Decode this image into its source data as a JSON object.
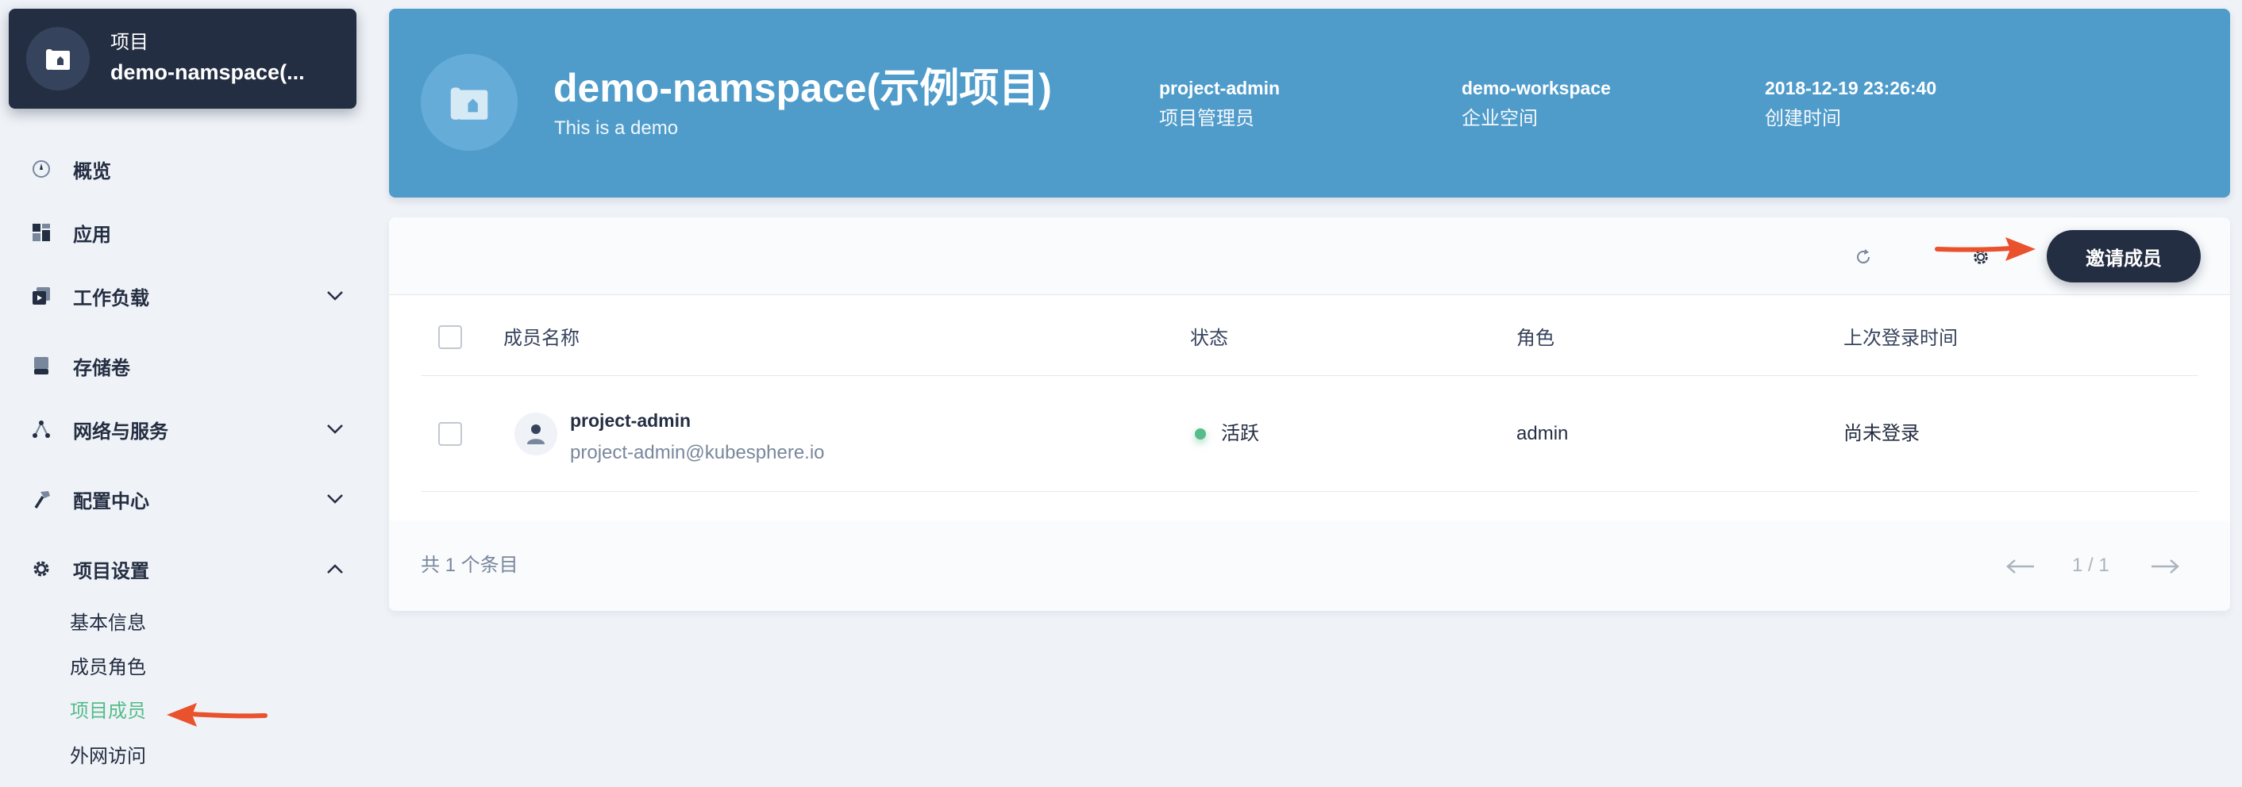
{
  "project_card": {
    "kind": "项目",
    "name": "demo-namspace(..."
  },
  "sidebar": {
    "items": [
      {
        "label": "概览"
      },
      {
        "label": "应用"
      },
      {
        "label": "工作负载"
      },
      {
        "label": "存储卷"
      },
      {
        "label": "网络与服务"
      },
      {
        "label": "配置中心"
      },
      {
        "label": "项目设置"
      }
    ],
    "sub_items": [
      {
        "label": "基本信息"
      },
      {
        "label": "成员角色"
      },
      {
        "label": "项目成员"
      },
      {
        "label": "外网访问"
      }
    ]
  },
  "banner": {
    "title": "demo-namspace(示例项目)",
    "description": "This is a demo",
    "meta": [
      {
        "value": "project-admin",
        "key": "项目管理员"
      },
      {
        "value": "demo-workspace",
        "key": "企业空间"
      },
      {
        "value": "2018-12-19 23:26:40",
        "key": "创建时间"
      }
    ]
  },
  "toolbar": {
    "invite_label": "邀请成员"
  },
  "table": {
    "headers": [
      "成员名称",
      "状态",
      "角色",
      "上次登录时间"
    ],
    "rows": [
      {
        "name": "project-admin",
        "email": "project-admin@kubesphere.io",
        "status": "活跃",
        "role": "admin",
        "last_login": "尚未登录"
      }
    ]
  },
  "footer": {
    "total": "共 1 个条目",
    "page": "1 / 1"
  },
  "colors": {
    "accent_green": "#55bc8a",
    "banner_blue": "#4f9ccb",
    "dark": "#242e42",
    "annotation_arrow": "#e9522d"
  }
}
